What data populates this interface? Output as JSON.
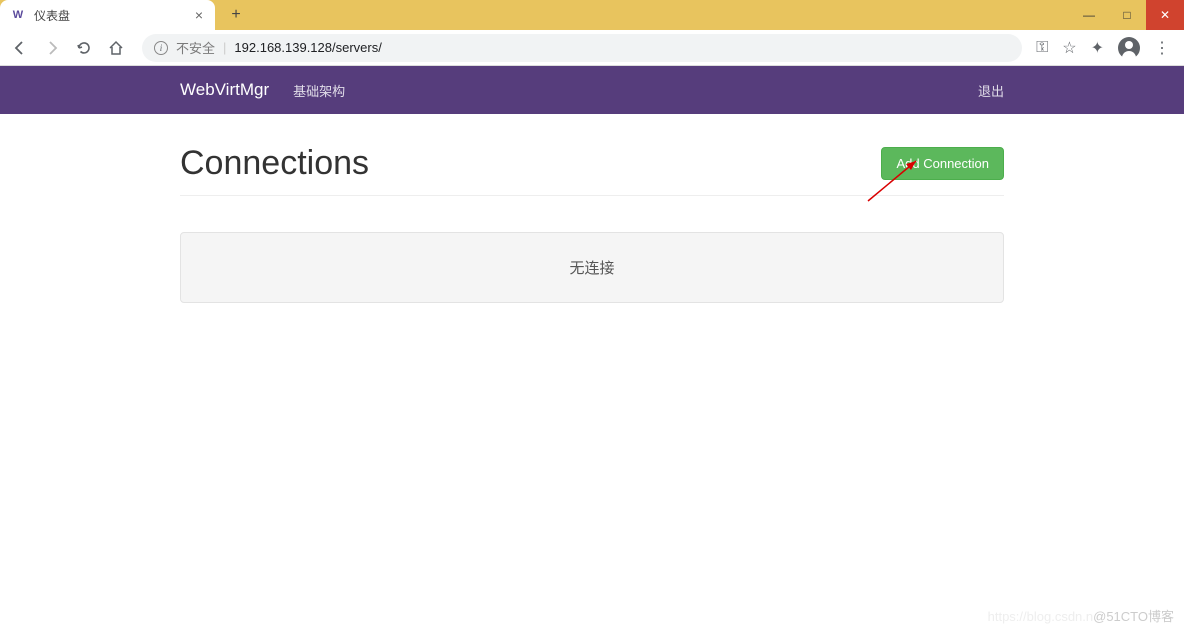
{
  "window": {
    "minimize": "—",
    "maximize": "□",
    "close": "✕"
  },
  "browser": {
    "tab_title": "仪表盘",
    "new_tab": "+",
    "tab_close": "×",
    "insecure_label": "不安全",
    "url": "192.168.139.128/servers/",
    "key_icon": "⚿",
    "star_icon": "☆",
    "ext_icon": "✦",
    "menu_icon": "⋮"
  },
  "navbar": {
    "brand": "WebVirtMgr",
    "infra_link": "基础架构",
    "logout": "退出"
  },
  "page": {
    "title": "Connections",
    "add_button": "Add Connection",
    "empty_message": "无连接"
  },
  "watermark": {
    "faint": "https://blog.csdn.n",
    "text": "@51CTO博客"
  }
}
